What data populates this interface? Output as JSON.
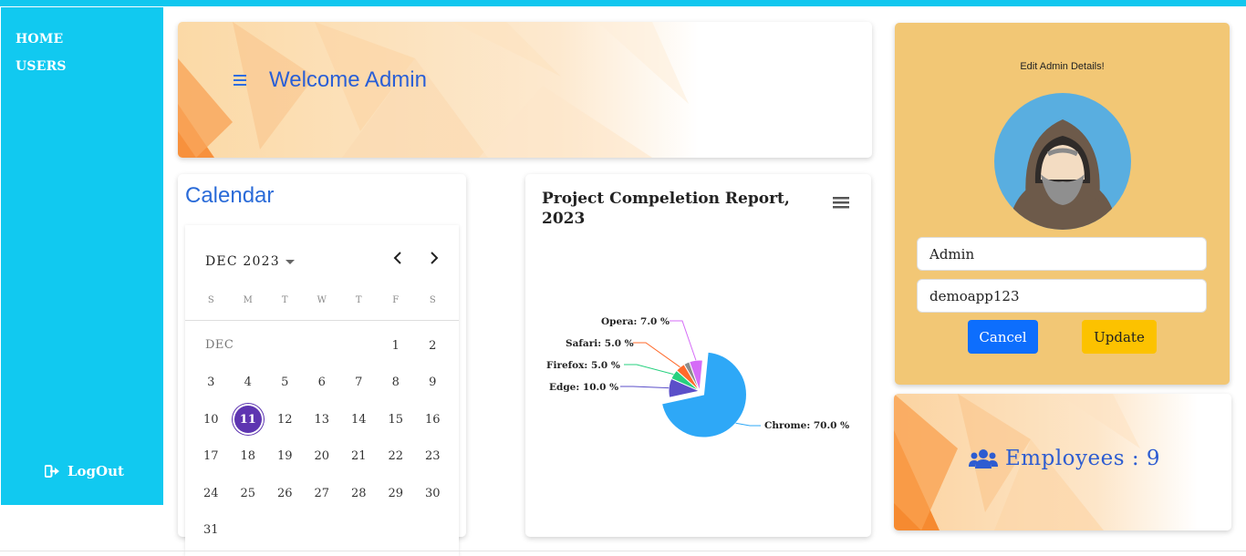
{
  "sidebar": {
    "items": [
      {
        "label": "HOME"
      },
      {
        "label": "USERS"
      }
    ],
    "logout_label": "LogOut"
  },
  "header": {
    "welcome": "Welcome Admin"
  },
  "calendar": {
    "title": "Calendar",
    "month_label": "DEC 2023",
    "weekdays": [
      "S",
      "M",
      "T",
      "W",
      "T",
      "F",
      "S"
    ],
    "month_short": "DEC",
    "selected_day": 11,
    "days": [
      "1",
      "2",
      "3",
      "4",
      "5",
      "6",
      "7",
      "8",
      "9",
      "10",
      "11",
      "12",
      "13",
      "14",
      "15",
      "16",
      "17",
      "18",
      "19",
      "20",
      "21",
      "22",
      "23",
      "24",
      "25",
      "26",
      "27",
      "28",
      "29",
      "30",
      "31"
    ]
  },
  "chart_data": {
    "type": "pie",
    "title": "Project Compeletion Report, 2023",
    "slices": [
      {
        "label": "Chrome: 70.0 %",
        "name": "Chrome",
        "value": 70.0,
        "color": "#2ea8f7"
      },
      {
        "label": "Edge: 10.0 %",
        "name": "Edge",
        "value": 10.0,
        "color": "#5b4fc9"
      },
      {
        "label": "Firefox: 5.0 %",
        "name": "Firefox",
        "value": 5.0,
        "color": "#27d17f"
      },
      {
        "label": "Safari: 5.0 %",
        "name": "Safari",
        "value": 5.0,
        "color": "#ff6a2b"
      },
      {
        "label": "Opera: 7.0 %",
        "name": "Opera",
        "value": 7.0,
        "color": "#d56cf7"
      }
    ],
    "other_value": 3.0,
    "other_color": "#8c8c8c"
  },
  "admin": {
    "caption": "Edit Admin Details!",
    "username_value": "Admin",
    "password_value": "demoapp123",
    "cancel_label": "Cancel",
    "update_label": "Update"
  },
  "employees": {
    "label": "Employees : 9"
  },
  "colors": {
    "sidebar": "#11c9f0",
    "accent_blue": "#2a5fd6",
    "admin_card": "#f2c775"
  }
}
